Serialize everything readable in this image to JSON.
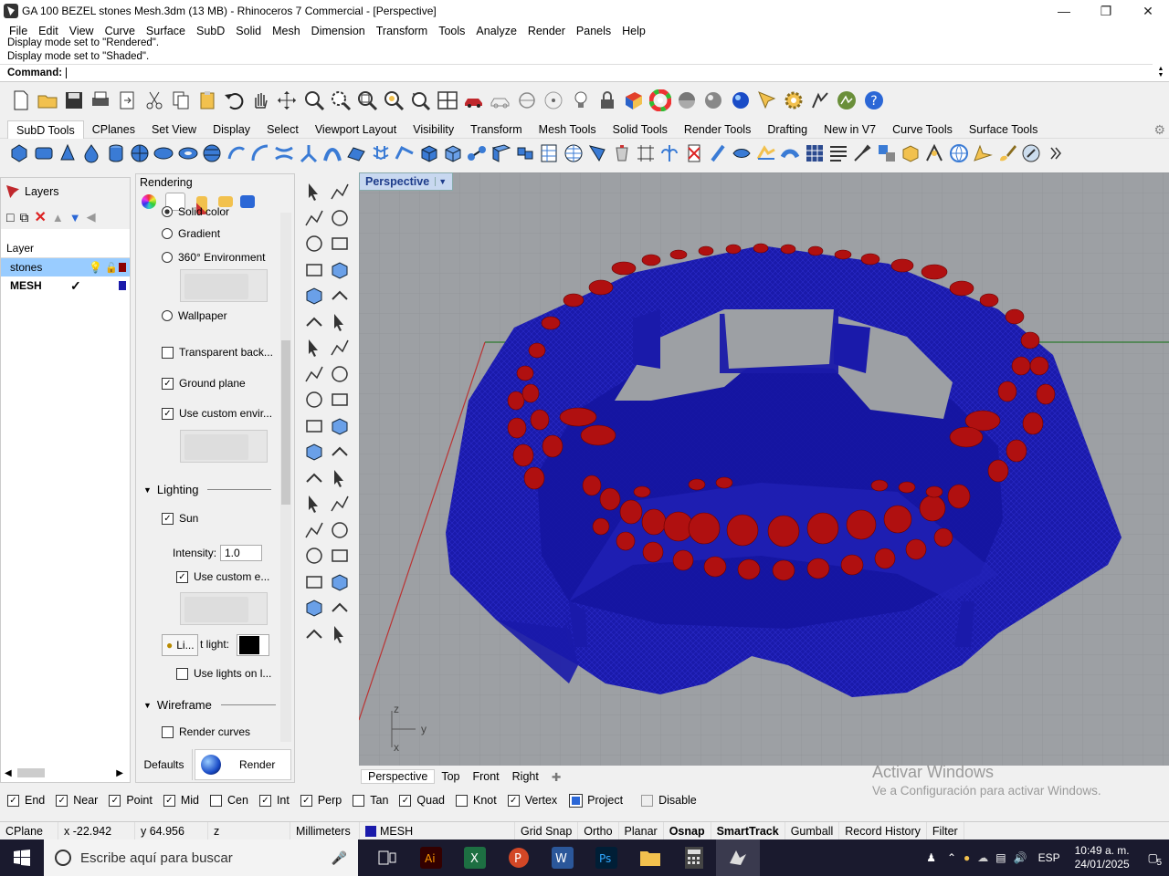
{
  "window": {
    "title": "GA 100 BEZEL stones Mesh.3dm (13 MB) - Rhinoceros 7 Commercial - [Perspective]"
  },
  "menu": [
    "File",
    "Edit",
    "View",
    "Curve",
    "Surface",
    "SubD",
    "Solid",
    "Mesh",
    "Dimension",
    "Transform",
    "Tools",
    "Analyze",
    "Render",
    "Panels",
    "Help"
  ],
  "command": {
    "history": [
      "Display mode set to \"Rendered\".",
      "Display mode set to \"Shaded\"."
    ],
    "prompt": "Command:"
  },
  "toolbar_tabs": [
    "SubD Tools",
    "CPlanes",
    "Set View",
    "Display",
    "Select",
    "Viewport Layout",
    "Visibility",
    "Transform",
    "Mesh Tools",
    "Solid Tools",
    "Render Tools",
    "Drafting",
    "New in V7",
    "Curve Tools",
    "Surface Tools"
  ],
  "layers": {
    "title": "Layers",
    "column": "Layer",
    "rows": [
      {
        "name": "stones",
        "color": "#8b0000"
      },
      {
        "name": "MESH",
        "color": "#1a1aaa",
        "check": "✓"
      }
    ]
  },
  "rendering": {
    "title": "Rendering",
    "solid_color": "Solid color",
    "gradient": "Gradient",
    "env360": "360° Environment",
    "wallpaper": "Wallpaper",
    "transparent": "Transparent back...",
    "ground": "Ground plane",
    "custom_env": "Use custom envir...",
    "lighting": "Lighting",
    "sun": "Sun",
    "intensity_label": "Intensity:",
    "intensity_value": "1.0",
    "use_custom": "Use custom e...",
    "light_btn": "Li...",
    "light_label": "t light:",
    "use_lights": "Use lights on l...",
    "wireframe": "Wireframe",
    "render_curves": "Render curves",
    "defaults": "Defaults",
    "render": "Render"
  },
  "viewport": {
    "title": "Perspective",
    "tabs": [
      "Perspective",
      "Top",
      "Front",
      "Right"
    ],
    "axis_z": "z",
    "axis_y": "y",
    "axis_x": "x"
  },
  "watermark": {
    "line1": "Activar Windows",
    "line2": "Ve a Configuración para activar Windows."
  },
  "osnap": [
    {
      "label": "End",
      "checked": true
    },
    {
      "label": "Near",
      "checked": true
    },
    {
      "label": "Point",
      "checked": true
    },
    {
      "label": "Mid",
      "checked": true
    },
    {
      "label": "Cen",
      "checked": false
    },
    {
      "label": "Int",
      "checked": true
    },
    {
      "label": "Perp",
      "checked": true
    },
    {
      "label": "Tan",
      "checked": false
    },
    {
      "label": "Quad",
      "checked": true
    },
    {
      "label": "Knot",
      "checked": false
    },
    {
      "label": "Vertex",
      "checked": true
    },
    {
      "label": "Project",
      "checked": false
    },
    {
      "label": "Disable",
      "checked": false
    }
  ],
  "status": {
    "cplane": "CPlane",
    "x": "x -22.942",
    "y": "y 64.956",
    "z": "z",
    "units": "Millimeters",
    "layer": "MESH",
    "toggles": [
      "Grid Snap",
      "Ortho",
      "Planar",
      "Osnap",
      "SmartTrack",
      "Gumball",
      "Record History",
      "Filter"
    ]
  },
  "taskbar": {
    "search": "Escribe aquí para buscar",
    "lang": "ESP",
    "time": "10:49 a. m.",
    "date": "24/01/2025",
    "notif": "5"
  },
  "colors": {
    "mesh": "#1a1aaa",
    "stones": "#b01010",
    "viewport_bg": "#9da0a4"
  }
}
